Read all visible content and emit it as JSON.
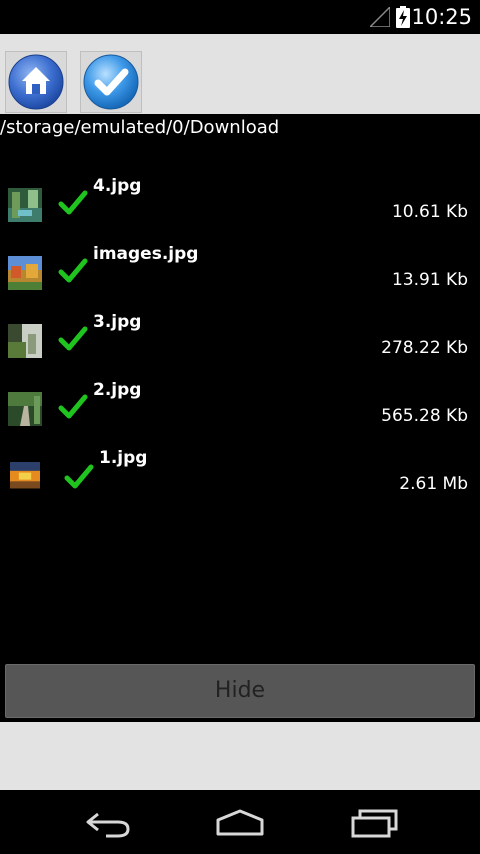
{
  "status_bar": {
    "time": "10:25",
    "icons": [
      "signal-icon",
      "battery-charging-icon"
    ]
  },
  "toolbar": {
    "buttons": [
      {
        "name": "home",
        "icon": "home-icon"
      },
      {
        "name": "select-all",
        "icon": "checkmark-icon"
      }
    ]
  },
  "path": "/storage/emulated/0/Download",
  "files": [
    {
      "name": "4.jpg",
      "size": "10.61 Kb"
    },
    {
      "name": "images.jpg",
      "size": "13.91 Kb"
    },
    {
      "name": "3.jpg",
      "size": "278.22 Kb"
    },
    {
      "name": "2.jpg",
      "size": "565.28 Kb"
    },
    {
      "name": "1.jpg",
      "size": "2.61 Mb"
    }
  ],
  "hide_button": {
    "label": "Hide"
  },
  "nav_bar": {
    "icons": [
      "back-icon",
      "home-icon",
      "recent-apps-icon"
    ]
  },
  "colors": {
    "check_green": "#1fc41f",
    "toolbar_bg": "#e2e2e2",
    "button_bg": "#565656"
  }
}
